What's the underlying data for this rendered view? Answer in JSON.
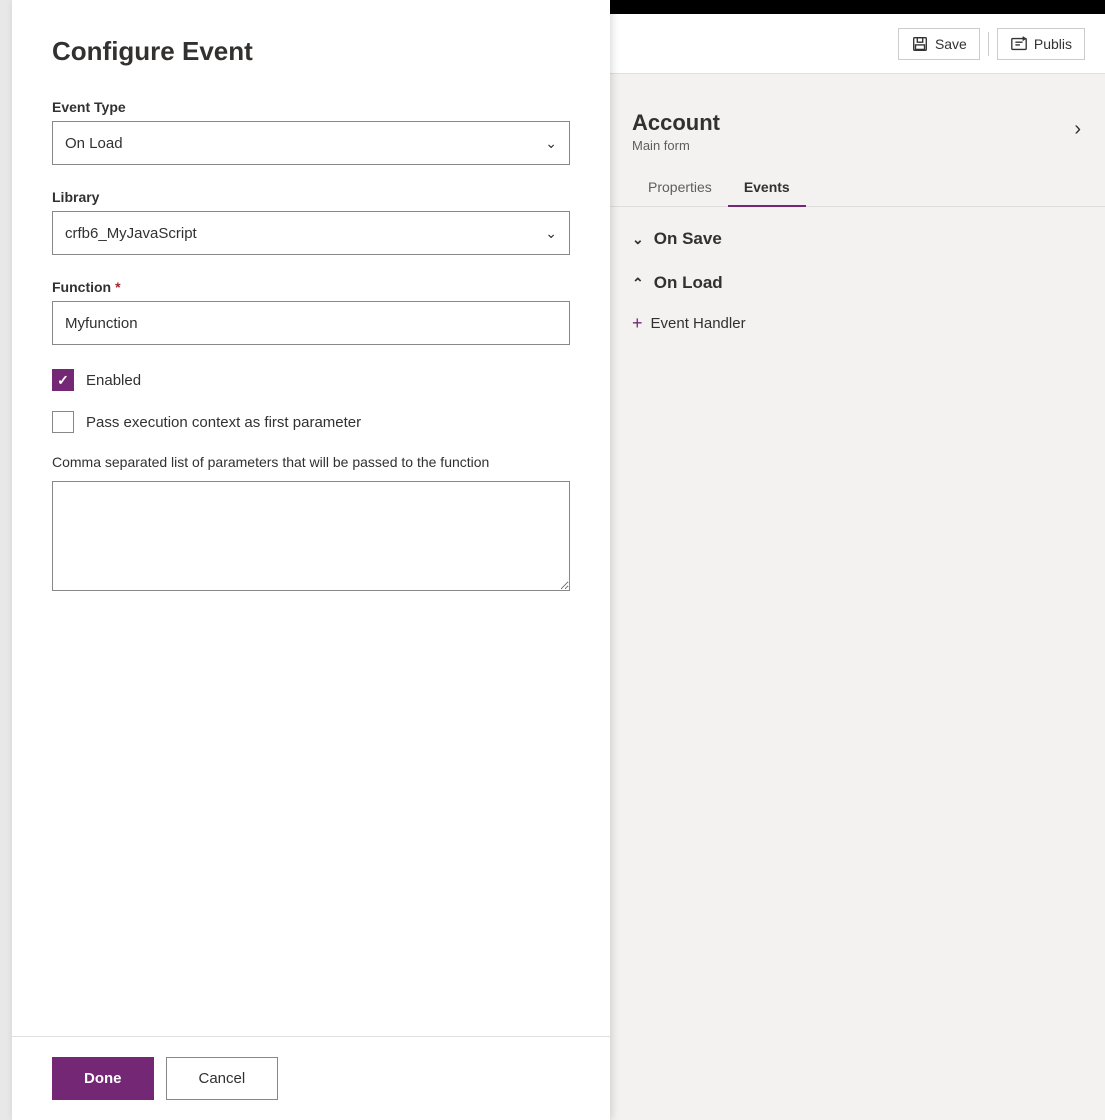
{
  "dialog": {
    "title": "Configure Event",
    "event_type_label": "Event Type",
    "event_type_value": "On Load",
    "library_label": "Library",
    "library_value": "crfb6_MyJavaScript",
    "function_label": "Function",
    "function_required": "*",
    "function_value": "Myfunction",
    "enabled_label": "Enabled",
    "enabled_checked": true,
    "pass_context_label": "Pass execution context as first parameter",
    "pass_context_checked": false,
    "params_label": "Comma separated list of parameters that will be passed to the function",
    "params_value": "",
    "done_label": "Done",
    "cancel_label": "Cancel"
  },
  "right_panel": {
    "account_title": "Account",
    "account_subtitle": "Main form",
    "tab_properties": "Properties",
    "tab_events": "Events",
    "active_tab": "Events",
    "save_label": "Save",
    "publish_label": "Publis",
    "on_save_label": "On Save",
    "on_load_label": "On Load",
    "event_handler_label": "Event Handler"
  }
}
